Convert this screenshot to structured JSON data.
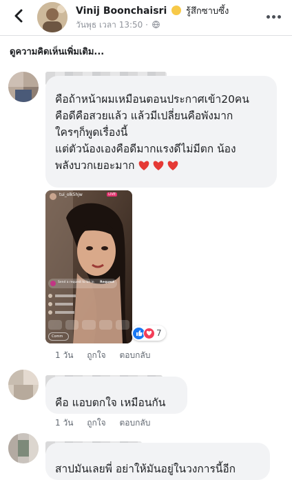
{
  "header": {
    "name": "Vinij Boonchaisri",
    "feeling": "รู้สึกซาบซึ้ง",
    "meta": "วันพุธ เวลา 13:50 ·"
  },
  "more_comments_label": "ดูความคิดเห็นเพิ่มเติม...",
  "comments": [
    {
      "lines": [
        "คือถ้าหน้าผมเหมือนตอนประกาศเข้า20คน",
        "คือดีคือสวยแล้ว แล้วมีเปลี่ยนคือพังมาก",
        "ใครๆก็พูดเรื่องนี้",
        "แต่ตัวน้องเองคือดีมากแรงดีไม่มีตก น้อง",
        "พลังบวกเยอะมาก"
      ],
      "reaction_count": "7",
      "time": "1 วัน",
      "like_label": "ถูกใจ",
      "reply_label": "ตอบกลับ"
    },
    {
      "lines": [
        "คือ แอบตกใจ เหมือนกัน"
      ],
      "time": "1 วัน",
      "like_label": "ถูกใจ",
      "reply_label": "ตอบกลับ"
    },
    {
      "lines": [
        "สาปมันเลยพี่ อย่าให้มันอยู่ในวงการนี้อีก"
      ]
    }
  ],
  "media_overlay": {
    "username": "tui_olk5hjw",
    "live_badge": "LIVE",
    "request_text": "Send a request to be in",
    "request_button": "Request",
    "comment_placeholder": "Comm"
  },
  "icons": {
    "back": "chevron-left-icon",
    "more": "more-dots-icon",
    "globe": "globe-icon",
    "heart": "red-heart-emoji",
    "like": "like-reaction-icon",
    "love": "love-reaction-icon"
  },
  "colors": {
    "bubble": "#f2f3f5",
    "meta_text": "#90949c",
    "heart": "#e53935",
    "like_blue": "#1877f2",
    "love_red": "#f33e58"
  }
}
